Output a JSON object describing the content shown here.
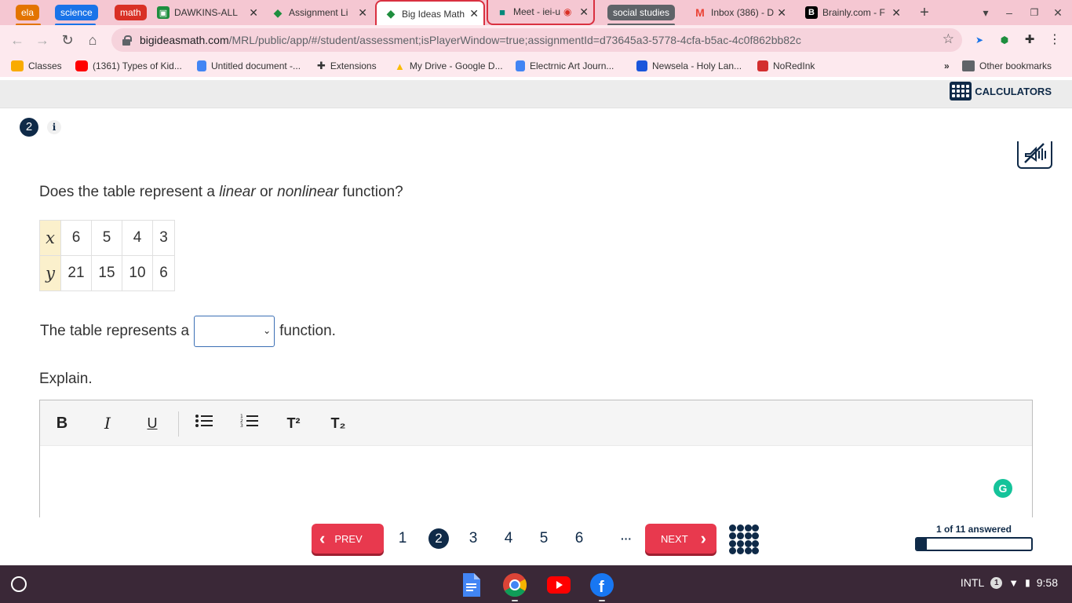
{
  "browser": {
    "tab_groups": [
      {
        "label": "ela",
        "color": "#e37400"
      },
      {
        "label": "science",
        "color": "#1a73e8"
      },
      {
        "label": "math",
        "color": "#d93025"
      },
      {
        "label": "social studies",
        "color": "#5f6368"
      }
    ],
    "tabs": [
      {
        "title": "DAWKINS-ALL",
        "icon": "classroom-icon",
        "color": "#1e8e3e"
      },
      {
        "title": "Assignment Li",
        "icon": "big-ideas-icon",
        "color": "#1e8e3e"
      },
      {
        "title": "Big Ideas Math",
        "icon": "big-ideas-icon",
        "color": "#1e8e3e"
      },
      {
        "title": "Meet - iei-u",
        "icon": "meet-icon",
        "color": "#00897b"
      },
      {
        "title": "Inbox (386) - D",
        "icon": "gmail-icon",
        "color": "#ea4335"
      },
      {
        "title": "Brainly.com - F",
        "icon": "brainly-icon",
        "color": "#000000"
      }
    ],
    "active_tab_index": 2,
    "url": {
      "domain": "bigideasmath.com",
      "path": "/MRL/public/app/#/student/assessment;isPlayerWindow=true;assignmentId=d73645a3-5778-4cfa-b5ac-4c0f862bb82c"
    },
    "bookmarks": [
      {
        "label": "Classes",
        "icon": "classroom-icon",
        "color": "#f9ab00"
      },
      {
        "label": "(1361) Types of Kid...",
        "icon": "youtube-icon",
        "color": "#ff0000"
      },
      {
        "label": "Untitled document -...",
        "icon": "docs-icon",
        "color": "#4285f4"
      },
      {
        "label": "Extensions",
        "icon": "puzzle-icon",
        "color": "#333333"
      },
      {
        "label": "My Drive - Google D...",
        "icon": "drive-icon",
        "color": "#fbbc04"
      },
      {
        "label": "Electrnic Art Journ...",
        "icon": "docs-icon",
        "color": "#4285f4"
      },
      {
        "label": "Newsela - Holy Lan...",
        "icon": "newsela-icon",
        "color": "#1a56db"
      },
      {
        "label": "NoRedInk",
        "icon": "noredink-icon",
        "color": "#d32f2f"
      }
    ],
    "other_bookmarks": "Other bookmarks"
  },
  "assessment": {
    "calculators_label": "CALCULATORS",
    "question_number": "2",
    "info_icon": "i",
    "question": {
      "pre": "Does the table represent a ",
      "em1": "linear",
      "mid": " or ",
      "em2": "nonlinear",
      "post": " function?"
    },
    "table": {
      "rows": [
        {
          "header": "x",
          "cells": [
            "6",
            "5",
            "4",
            "3"
          ]
        },
        {
          "header": "y",
          "cells": [
            "21",
            "15",
            "10",
            "6"
          ]
        }
      ]
    },
    "answer": {
      "prefix": "The table represents a",
      "selected": "",
      "suffix": "function."
    },
    "explain_label": "Explain.",
    "editor_tools": [
      "B",
      "I",
      "U",
      "bulleted-list-icon",
      "numbered-list-icon",
      "T²",
      "T₂"
    ],
    "grammarly_icon": "G"
  },
  "pager": {
    "prev_label": "PREV",
    "next_label": "NEXT",
    "pages": [
      "1",
      "2",
      "3",
      "4",
      "5",
      "6"
    ],
    "current_page": "2",
    "ellipsis": "···",
    "progress_label": "1 of 11 answered",
    "progress_fraction": 0.091
  },
  "shelf": {
    "apps": [
      {
        "name": "docs-app",
        "color": "#4285f4"
      },
      {
        "name": "chrome-app",
        "color": "#db4437"
      },
      {
        "name": "youtube-app",
        "color": "#ff0000"
      },
      {
        "name": "facebook-app",
        "color": "#1877f2"
      }
    ],
    "ime": "INTL",
    "notification_count": "1",
    "time": "9:58"
  }
}
